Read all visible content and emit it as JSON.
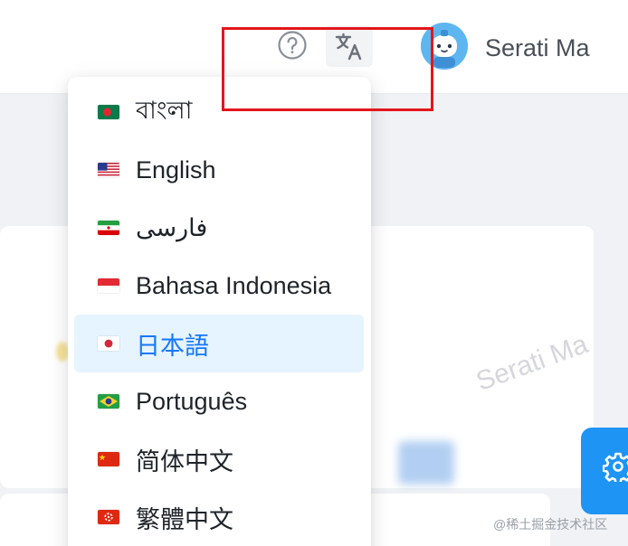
{
  "header": {
    "user_name": "Serati Ma",
    "icons": {
      "help": "question-circle-icon",
      "translate": "translate-icon",
      "avatar": "avatar-robot"
    }
  },
  "language_menu": {
    "selected_index": 4,
    "items": [
      {
        "label": "বাংলা",
        "flag": "bangladesh-flag"
      },
      {
        "label": "English",
        "flag": "usa-flag"
      },
      {
        "label": "فارسی",
        "flag": "iran-flag"
      },
      {
        "label": "Bahasa Indonesia",
        "flag": "indonesia-flag"
      },
      {
        "label": "日本語",
        "flag": "japan-flag"
      },
      {
        "label": "Português",
        "flag": "brazil-flag"
      },
      {
        "label": "简体中文",
        "flag": "china-flag"
      },
      {
        "label": "繁體中文",
        "flag": "hong-kong-flag"
      }
    ]
  },
  "watermark": "Serati Ma",
  "footer_credit": "@稀土掘金技术社区",
  "colors": {
    "accent": "#1677ff",
    "selected_bg": "#e6f4ff",
    "fab": "#1e94f4",
    "highlight": "#e3161c"
  }
}
